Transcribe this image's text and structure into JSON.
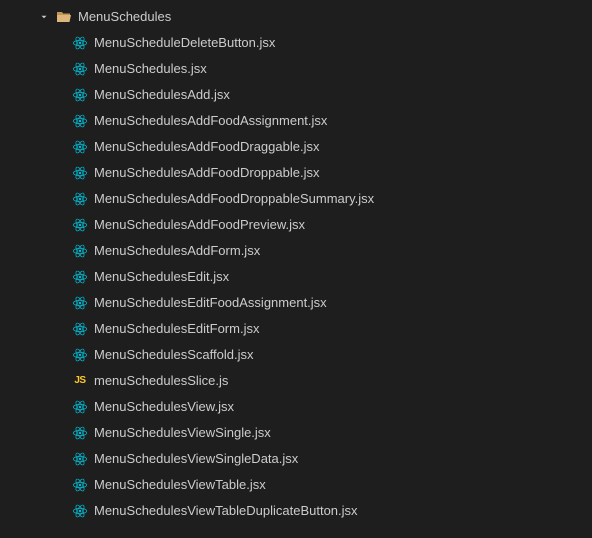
{
  "folder": {
    "name": "MenuSchedules",
    "expanded": true
  },
  "files": [
    {
      "name": "MenuScheduleDeleteButton.jsx",
      "icon": "react"
    },
    {
      "name": "MenuSchedules.jsx",
      "icon": "react"
    },
    {
      "name": "MenuSchedulesAdd.jsx",
      "icon": "react"
    },
    {
      "name": "MenuSchedulesAddFoodAssignment.jsx",
      "icon": "react"
    },
    {
      "name": "MenuSchedulesAddFoodDraggable.jsx",
      "icon": "react"
    },
    {
      "name": "MenuSchedulesAddFoodDroppable.jsx",
      "icon": "react"
    },
    {
      "name": "MenuSchedulesAddFoodDroppableSummary.jsx",
      "icon": "react"
    },
    {
      "name": "MenuSchedulesAddFoodPreview.jsx",
      "icon": "react"
    },
    {
      "name": "MenuSchedulesAddForm.jsx",
      "icon": "react"
    },
    {
      "name": "MenuSchedulesEdit.jsx",
      "icon": "react"
    },
    {
      "name": "MenuSchedulesEditFoodAssignment.jsx",
      "icon": "react"
    },
    {
      "name": "MenuSchedulesEditForm.jsx",
      "icon": "react"
    },
    {
      "name": "MenuSchedulesScaffold.jsx",
      "icon": "react"
    },
    {
      "name": "menuSchedulesSlice.js",
      "icon": "js"
    },
    {
      "name": "MenuSchedulesView.jsx",
      "icon": "react"
    },
    {
      "name": "MenuSchedulesViewSingle.jsx",
      "icon": "react"
    },
    {
      "name": "MenuSchedulesViewSingleData.jsx",
      "icon": "react"
    },
    {
      "name": "MenuSchedulesViewTable.jsx",
      "icon": "react"
    },
    {
      "name": "MenuSchedulesViewTableDuplicateButton.jsx",
      "icon": "react"
    }
  ],
  "icons": {
    "js_label": "JS"
  }
}
